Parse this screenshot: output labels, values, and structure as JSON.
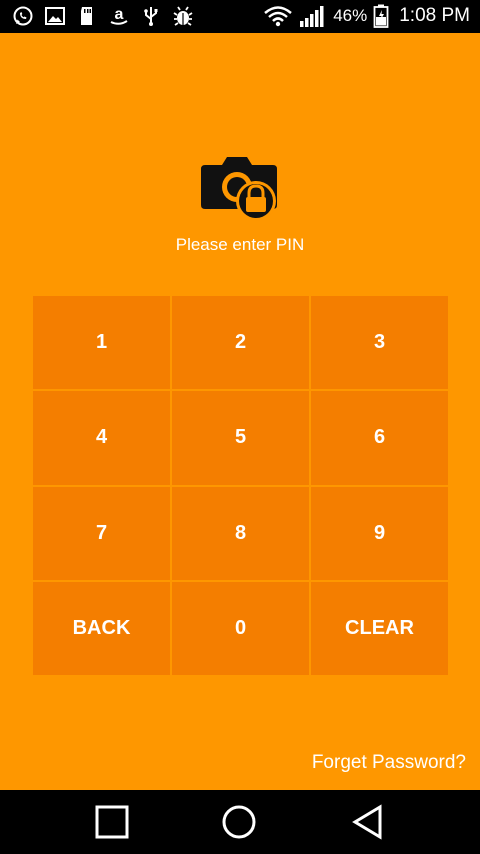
{
  "status_bar": {
    "battery_percent": "46%",
    "time": "1:08 PM",
    "left_icons": [
      "whatsapp-icon",
      "gallery-icon",
      "sd-card-icon",
      "amazon-icon",
      "usb-icon",
      "android-debug-icon"
    ],
    "right_icons": [
      "wifi-icon",
      "signal-icon",
      "battery-icon"
    ]
  },
  "lock_screen": {
    "icon": "camera-lock-icon",
    "prompt": "Please enter PIN",
    "keys": [
      "1",
      "2",
      "3",
      "4",
      "5",
      "6",
      "7",
      "8",
      "9",
      "BACK",
      "0",
      "CLEAR"
    ],
    "forgot_link": "Forget Password?"
  },
  "nav_bar": {
    "buttons": [
      "recents-icon",
      "home-icon",
      "back-icon"
    ]
  },
  "colors": {
    "background": "#fe9700",
    "key_background": "#f47e00",
    "text": "#ffffff"
  }
}
